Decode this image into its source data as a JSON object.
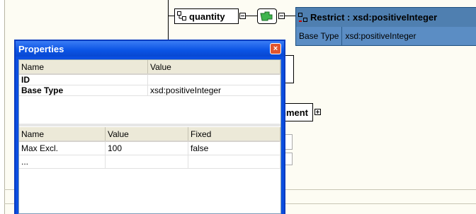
{
  "diagram": {
    "quantity_label": "quantity",
    "restrict_title": "Restrict :",
    "restrict_type": "xsd:positiveInteger",
    "base_type_label": "Base Type",
    "base_type_value": "xsd:positiveInteger",
    "partial_node_label": "nment"
  },
  "properties": {
    "title": "Properties",
    "close_glyph": "×",
    "top_table": {
      "columns": [
        "Name",
        "Value"
      ],
      "rows": [
        {
          "name": "ID",
          "value": ""
        },
        {
          "name": "Base Type",
          "value": "xsd:positiveInteger"
        }
      ]
    },
    "facets_table": {
      "columns": [
        "Name",
        "Value",
        "Fixed"
      ],
      "rows": [
        {
          "name": "Max Excl.",
          "value": "100",
          "fixed": "false"
        },
        {
          "name": "...",
          "value": "",
          "fixed": ""
        }
      ]
    }
  },
  "colors": {
    "title_bar": "#0b54e5",
    "restrict_head": "#4f7fb0",
    "restrict_body": "#5b8dc4"
  }
}
